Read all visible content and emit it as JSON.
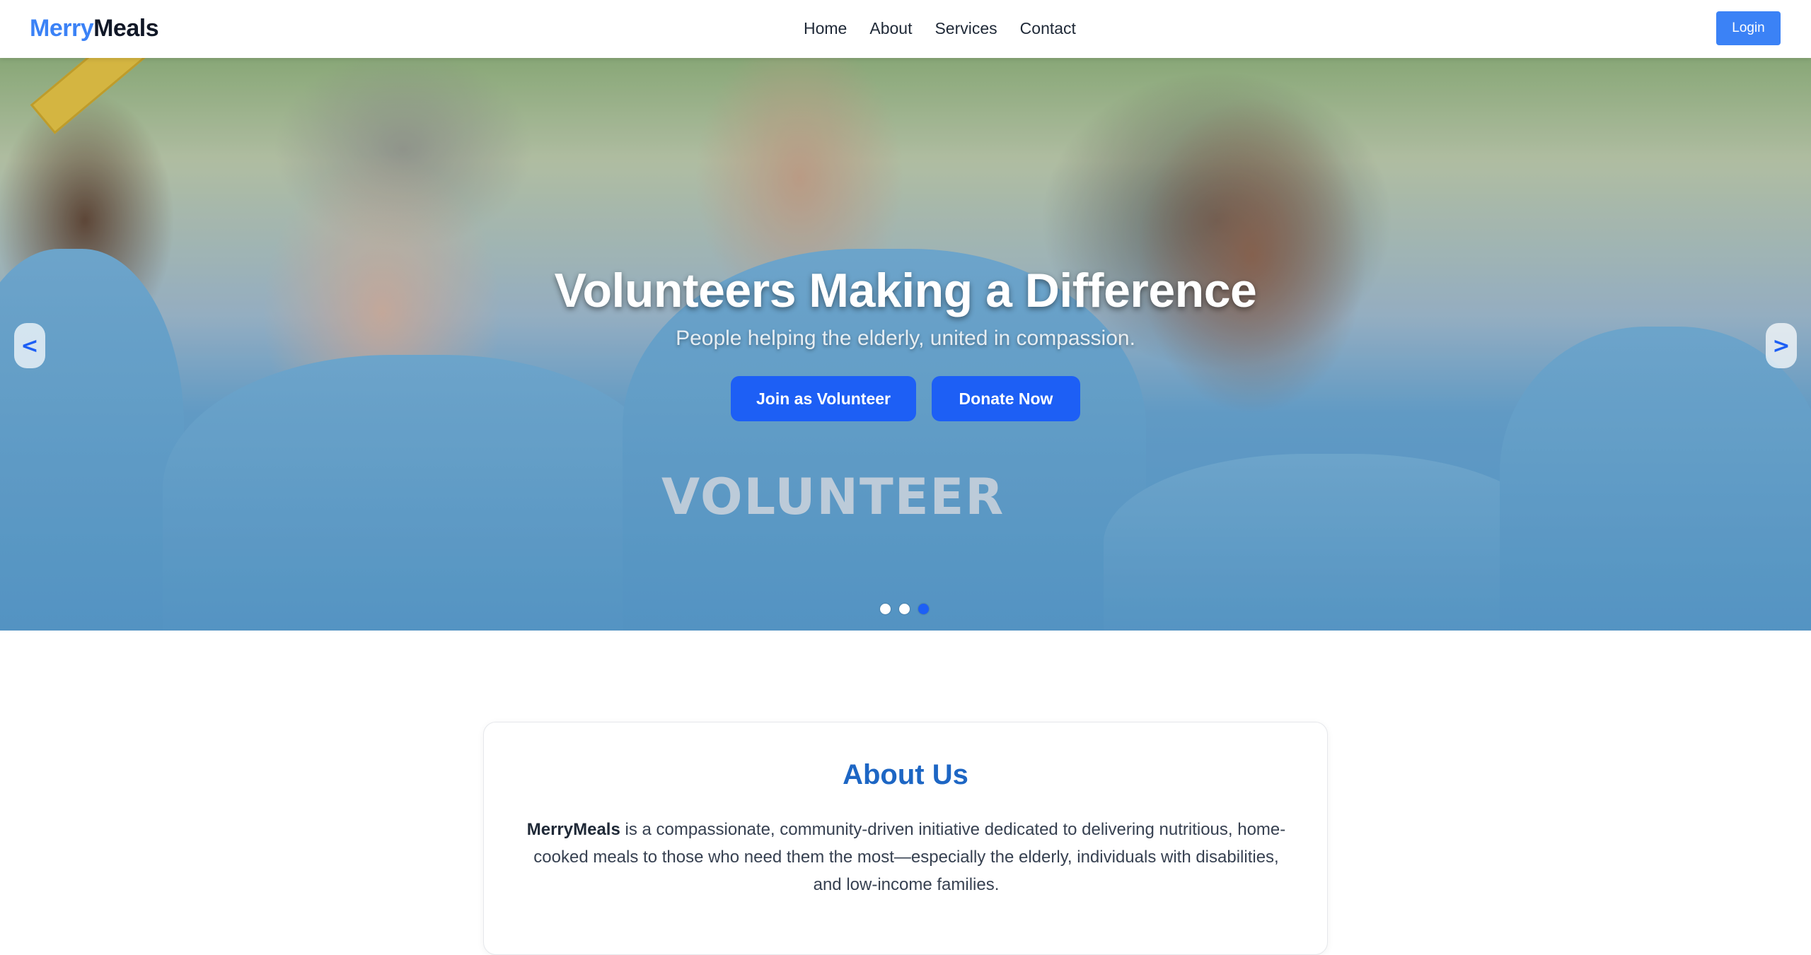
{
  "brand": {
    "part1": "Merry",
    "part2": "Meals"
  },
  "nav": {
    "links": [
      {
        "label": "Home"
      },
      {
        "label": "About"
      },
      {
        "label": "Services"
      },
      {
        "label": "Contact"
      }
    ],
    "login_label": "Login"
  },
  "hero": {
    "title": "Volunteers Making a Difference",
    "subtitle": "People helping the elderly, united in compassion.",
    "primary_button": "Join as Volunteer",
    "secondary_button": "Donate Now",
    "prev_label": "<",
    "next_label": ">",
    "slides_total": 3,
    "active_slide": 3,
    "shirt_text": "VOLUNTEER"
  },
  "about": {
    "title": "About Us",
    "brand_bold": "MerryMeals",
    "text": " is a compassionate, community-driven initiative dedicated to delivering nutritious, home-cooked meals to those who need them the most—especially the elderly, individuals with disabilities, and low-income families."
  },
  "colors": {
    "accent": "#3b82f6",
    "hero_button": "#1d5ff5",
    "about_title": "#1d66c4"
  }
}
